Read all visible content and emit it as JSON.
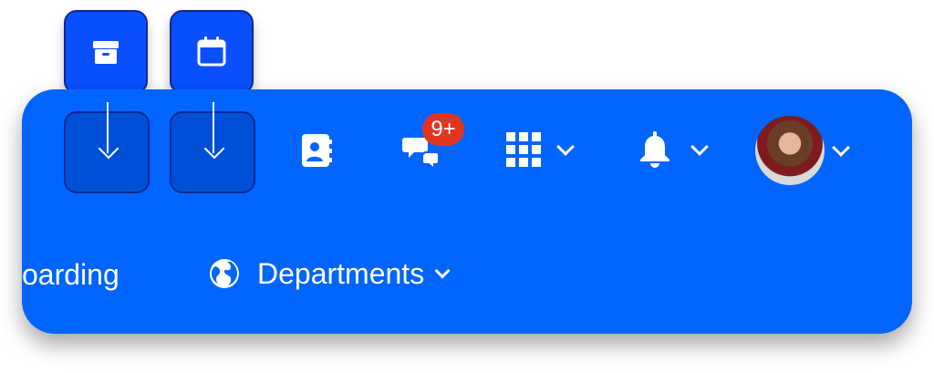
{
  "floating_buttons": [
    {
      "name": "archive",
      "icon": "archive-icon"
    },
    {
      "name": "calendar",
      "icon": "calendar-icon"
    }
  ],
  "toolbar": {
    "contacts_icon": "address-book-icon",
    "chat_icon": "chat-bubbles-icon",
    "chat_badge": "9+",
    "apps_icon": "grid-icon",
    "notifications_icon": "bell-icon",
    "avatar": "user-avatar"
  },
  "nav": {
    "item_partial": "oarding",
    "departments": "Departments"
  },
  "colors": {
    "panel": "#0065ff",
    "badge": "#e0351e",
    "floating_button": "#0a50ff"
  }
}
